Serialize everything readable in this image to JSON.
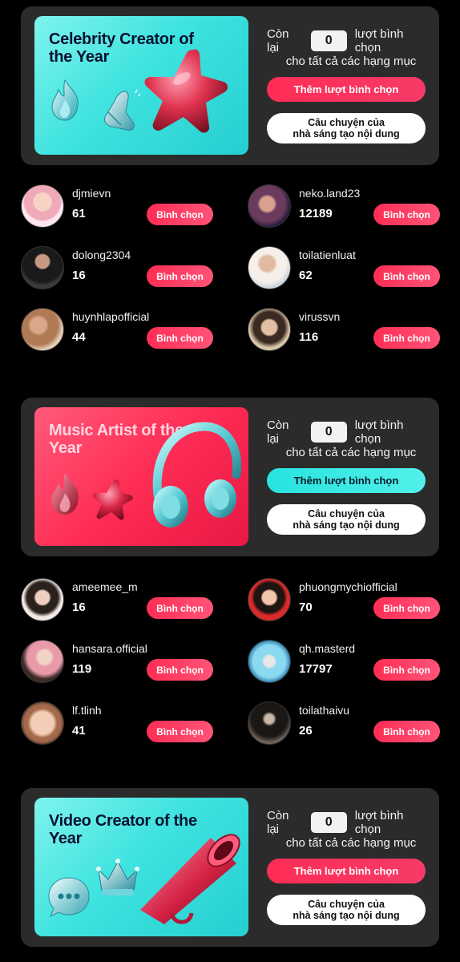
{
  "sections": [
    {
      "banner_title": "Celebrity Creator of the Year",
      "votes_prefix": "Còn lại",
      "votes_count": "0",
      "votes_suffix": "lượt bình chọn",
      "votes_sub": "cho tất cả các hạng mục",
      "add_votes_label": "Thêm lượt bình chọn",
      "story_label_line1": "Câu chuyện của",
      "story_label_line2": "nhà sáng tạo nội dung",
      "nominees": [
        {
          "name": "djmievn",
          "votes": "61",
          "button": "Bình chọn"
        },
        {
          "name": "neko.land23",
          "votes": "12189",
          "button": "Bình chọn"
        },
        {
          "name": "dolong2304",
          "votes": "16",
          "button": "Bình chọn"
        },
        {
          "name": "toilatienluat",
          "votes": "62",
          "button": "Bình chọn"
        },
        {
          "name": "huynhlapofficial",
          "votes": "44",
          "button": "Bình chọn"
        },
        {
          "name": "virussvn",
          "votes": "116",
          "button": "Bình chọn"
        }
      ]
    },
    {
      "banner_title": "Music Artist of the Year",
      "votes_prefix": "Còn lại",
      "votes_count": "0",
      "votes_suffix": "lượt bình chọn",
      "votes_sub": "cho tất cả các hạng mục",
      "add_votes_label": "Thêm lượt bình chọn",
      "story_label_line1": "Câu chuyện của",
      "story_label_line2": "nhà sáng tạo nội dung",
      "nominees": [
        {
          "name": "ameemee_m",
          "votes": "16",
          "button": "Bình chọn"
        },
        {
          "name": "phuongmychiofficial",
          "votes": "70",
          "button": "Bình chọn"
        },
        {
          "name": "hansara.official",
          "votes": "119",
          "button": "Bình chọn"
        },
        {
          "name": "qh.masterd",
          "votes": "17797",
          "button": "Bình chọn"
        },
        {
          "name": "lf.tlinh",
          "votes": "41",
          "button": "Bình chọn"
        },
        {
          "name": "toilathaivu",
          "votes": "26",
          "button": "Bình chọn"
        }
      ]
    },
    {
      "banner_title": "Video Creator of the Year",
      "votes_prefix": "Còn lại",
      "votes_count": "0",
      "votes_suffix": "lượt bình chọn",
      "votes_sub": "cho tất cả các hạng mục",
      "add_votes_label": "Thêm lượt bình chọn",
      "story_label_line1": "Câu chuyện của",
      "story_label_line2": "nhà sáng tạo nội dung"
    }
  ],
  "icons": {
    "section_1": [
      "flame-icon",
      "prayer-hands-icon",
      "star-icon"
    ],
    "section_2": [
      "flame-icon",
      "star-icon",
      "headphones-icon"
    ],
    "section_3": [
      "chat-bubble-icon",
      "crown-icon",
      "megaphone-icon"
    ]
  },
  "colors": {
    "background": "#000000",
    "card": "#2b2b2b",
    "accent_pink": "#ff2d55",
    "accent_cyan": "#25f4ee"
  }
}
